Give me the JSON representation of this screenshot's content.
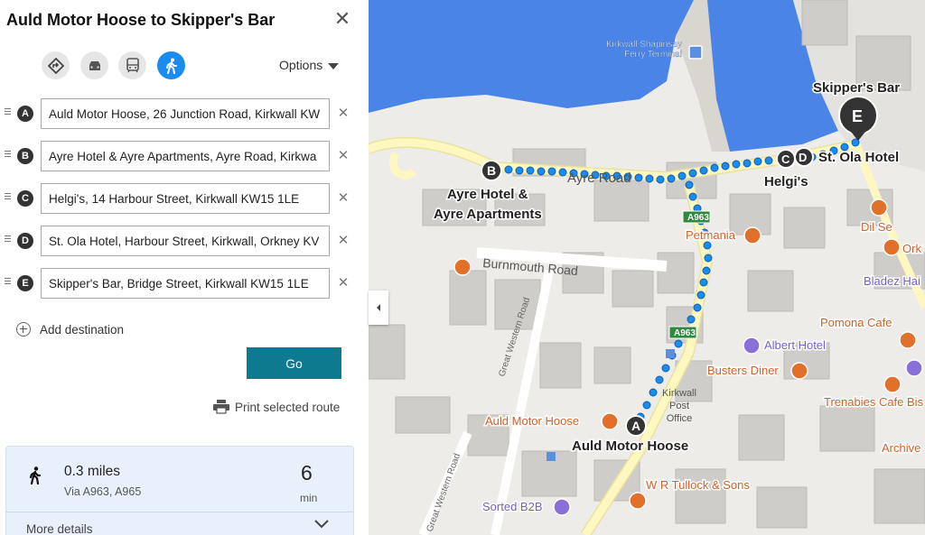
{
  "panel": {
    "title": "Auld Motor Hoose to Skipper's Bar",
    "options_label": "Options",
    "modes": [
      {
        "name": "directions-icon",
        "active": false
      },
      {
        "name": "car-icon",
        "active": false
      },
      {
        "name": "transit-icon",
        "active": false
      },
      {
        "name": "walk-icon",
        "active": true
      }
    ],
    "waypoints": [
      {
        "letter": "A",
        "value": "Auld Motor Hoose, 26 Junction Road, Kirkwall KW"
      },
      {
        "letter": "B",
        "value": "Ayre Hotel & Ayre Apartments, Ayre Road, Kirkwa"
      },
      {
        "letter": "C",
        "value": "Helgi's, 14 Harbour Street, Kirkwall KW15 1LE"
      },
      {
        "letter": "D",
        "value": "St. Ola Hotel, Harbour Street, Kirkwall, Orkney KV"
      },
      {
        "letter": "E",
        "value": "Skipper's Bar, Bridge Street, Kirkwall KW15 1LE"
      }
    ],
    "add_destination": "Add destination",
    "go_label": "Go",
    "print_label": "Print selected route"
  },
  "route_card": {
    "distance": "0.3 miles",
    "via": "Via A963, A965",
    "duration": "6",
    "duration_unit": "min",
    "more_details": "More details"
  },
  "map": {
    "labels": {
      "ferry": [
        "Kirkwall Shapinsay",
        "Ferry Terminal"
      ],
      "skippers": "Skipper's Bar",
      "st_ola": "St. Ola Hotel",
      "helgis": "Helgi's",
      "ayre": [
        "Ayre Hotel &",
        "Ayre Apartments"
      ],
      "ayre_road": "Ayre Road",
      "burnmouth": "Burnmouth Road",
      "great_western": "Great Western Road",
      "great_western_2": "Great Western Road",
      "a963_1": "A963",
      "a963_2": "A963",
      "petmania": "Petmania",
      "dil_se": "Dil Se",
      "ork": "Ork",
      "bladez": "Bladez Hai",
      "pomona": "Pomona Cafe",
      "albert": "Albert Hotel",
      "busters": "Busters Diner",
      "trenabies": "Trenabies Cafe Bis",
      "archive": "Archive",
      "post_office": [
        "Kirkwall",
        "Post",
        "Office"
      ],
      "auld_poi": "Auld Motor Hoose",
      "auld_pin": "Auld Motor Hoose",
      "tullock": "W R Tullock & Sons",
      "sorted": "Sorted B2B"
    },
    "pins": [
      "A",
      "B",
      "C",
      "D",
      "E"
    ],
    "colors": {
      "water": "#4a84e6",
      "land": "#eeece8",
      "route": "#1a8cf0",
      "poi_orange": "#e0702a",
      "poi_purple": "#8a6fd8",
      "road": "#fff7c0"
    }
  }
}
